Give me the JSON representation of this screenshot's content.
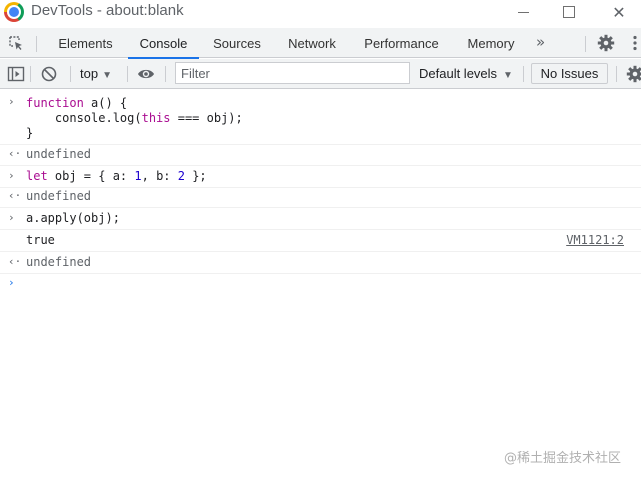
{
  "window": {
    "title": "DevTools - about:blank",
    "close_glyph": "✕"
  },
  "tabs": [
    {
      "label": "Elements",
      "active": false
    },
    {
      "label": "Console",
      "active": true
    },
    {
      "label": "Sources",
      "active": false
    },
    {
      "label": "Network",
      "active": false
    },
    {
      "label": "Performance",
      "active": false
    },
    {
      "label": "Memory",
      "active": false
    }
  ],
  "more_tabs_glyph": "»",
  "toolbar": {
    "context": "top",
    "filter_placeholder": "Filter",
    "levels": "Default levels",
    "issues": "No Issues"
  },
  "console": {
    "input_glyph": "›",
    "result_glyph": "‹·",
    "entries": [
      {
        "type": "input",
        "lines": [
          "function a() {",
          "    console.log(this === obj);",
          "}"
        ]
      },
      {
        "type": "result",
        "text": "undefined"
      },
      {
        "type": "input",
        "text": "let obj = { a: 1, b: 2 };"
      },
      {
        "type": "result",
        "text": "undefined"
      },
      {
        "type": "input",
        "text": "a.apply(obj);"
      },
      {
        "type": "log",
        "text": "true",
        "source": "VM1121:2"
      },
      {
        "type": "result",
        "text": "undefined"
      }
    ]
  },
  "watermark": "@稀土掘金技术社区",
  "colors": {
    "accent": "#1a73e8",
    "keyword": "#aa0d91",
    "number": "#1c00cf",
    "toolbar_bg": "#f1f3f4"
  }
}
